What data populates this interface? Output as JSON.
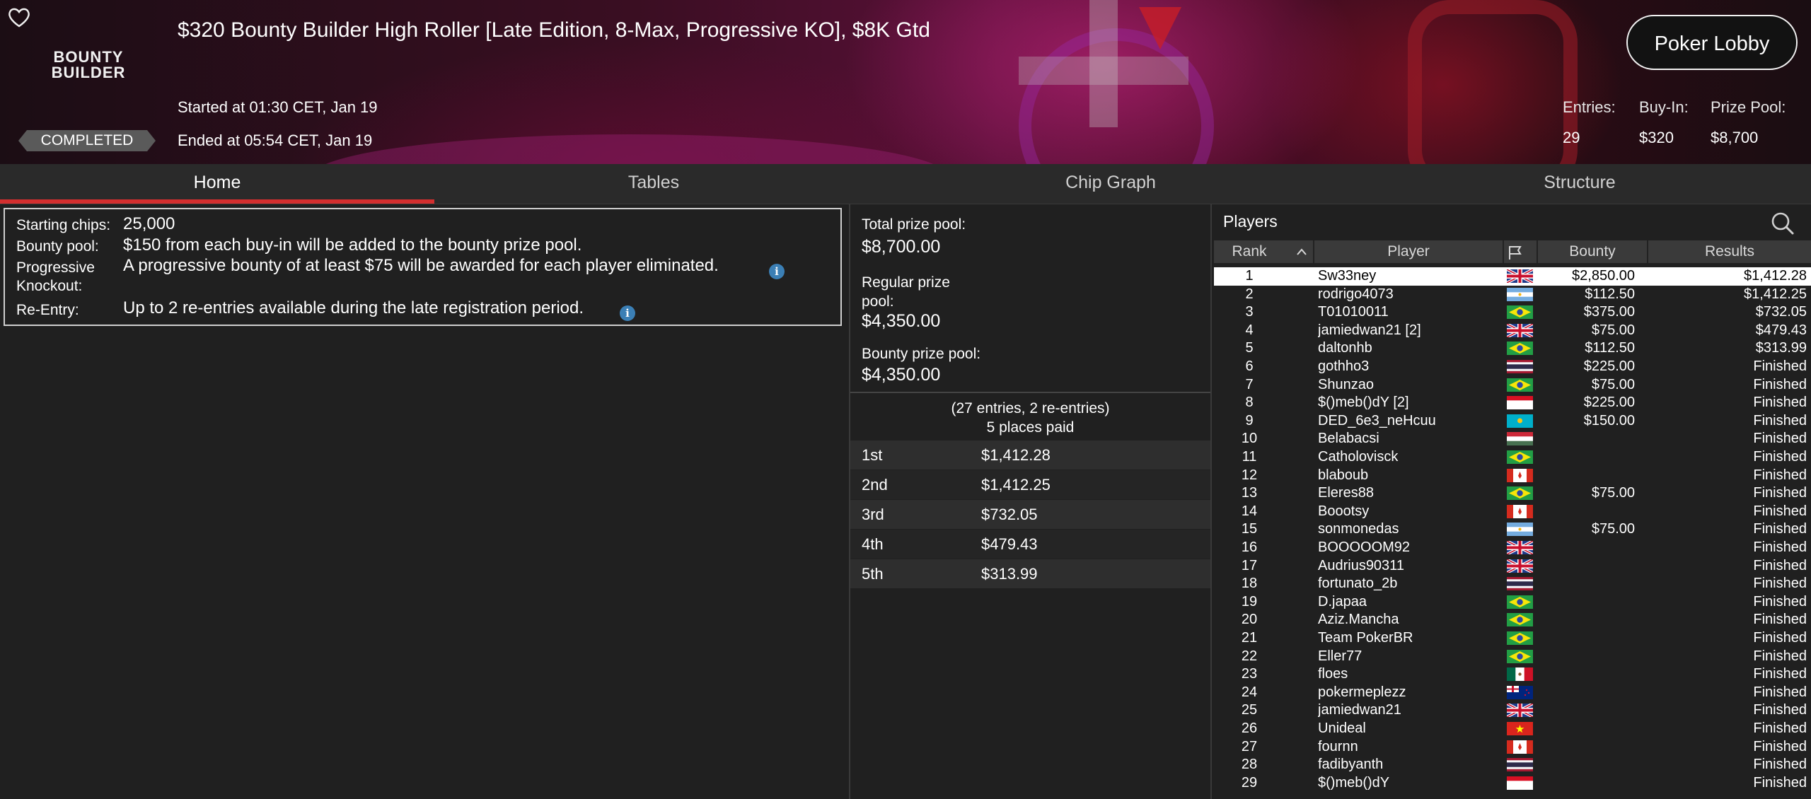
{
  "header": {
    "logo_line1": "BOUNTY",
    "logo_line2": "BUILDER",
    "status_badge": "COMPLETED",
    "title": "$320 Bounty Builder High Roller [Late Edition, 8-Max, Progressive KO], $8K Gtd",
    "started": "Started at 01:30 CET, Jan 19",
    "ended": "Ended at 05:54 CET, Jan 19",
    "lobby_button": "Poker Lobby",
    "stats": {
      "entries_label": "Entries:",
      "entries_value": "29",
      "buyin_label": "Buy-In:",
      "buyin_value": "$320",
      "prize_label": "Prize Pool:",
      "prize_value": "$8,700"
    },
    "icons": [
      "heart-icon"
    ]
  },
  "tabs": [
    {
      "label": "Home",
      "active": true
    },
    {
      "label": "Tables",
      "active": false
    },
    {
      "label": "Chip Graph",
      "active": false
    },
    {
      "label": "Structure",
      "active": false
    }
  ],
  "info": {
    "starting_chips_label": "Starting chips:",
    "starting_chips_value": "25,000",
    "bounty_pool_label": "Bounty pool:",
    "bounty_pool_value": "$150 from each buy-in will be added to the bounty prize pool.",
    "pko_label_1": "Progressive",
    "pko_label_2": "Knockout:",
    "pko_value": "A progressive bounty of at least $75 will be awarded for each player eliminated.",
    "reentry_label": "Re-Entry:",
    "reentry_value": "Up to 2 re-entries available during the late registration period.",
    "info_icon_glyph": "i"
  },
  "prize": {
    "total_label": "Total prize pool:",
    "total_value": "$8,700.00",
    "regular_label_1": "Regular prize",
    "regular_label_2": "pool:",
    "regular_value": "$4,350.00",
    "bounty_label": "Bounty prize pool:",
    "bounty_value": "$4,350.00",
    "entries_note": "(27 entries, 2 re-entries)",
    "places_paid": "5 places paid",
    "places": [
      {
        "place": "1st",
        "amount": "$1,412.28"
      },
      {
        "place": "2nd",
        "amount": "$1,412.25"
      },
      {
        "place": "3rd",
        "amount": "$732.05"
      },
      {
        "place": "4th",
        "amount": "$479.43"
      },
      {
        "place": "5th",
        "amount": "$313.99"
      }
    ]
  },
  "players": {
    "title": "Players",
    "columns": {
      "rank": "Rank",
      "player": "Player",
      "bounty": "Bounty",
      "results": "Results"
    },
    "selected_rank": 1,
    "rows": [
      {
        "rank": "1",
        "name": "Sw33ney",
        "flag": "gb",
        "bounty": "$2,850.00",
        "result": "$1,412.28"
      },
      {
        "rank": "2",
        "name": "rodrigo4073",
        "flag": "ar",
        "bounty": "$112.50",
        "result": "$1,412.25"
      },
      {
        "rank": "3",
        "name": "T01010011",
        "flag": "br",
        "bounty": "$375.00",
        "result": "$732.05"
      },
      {
        "rank": "4",
        "name": "jamiedwan21 [2]",
        "flag": "gb",
        "bounty": "$75.00",
        "result": "$479.43"
      },
      {
        "rank": "5",
        "name": "daltonhb",
        "flag": "br",
        "bounty": "$112.50",
        "result": "$313.99"
      },
      {
        "rank": "6",
        "name": "gothho3",
        "flag": "th",
        "bounty": "$225.00",
        "result": "Finished"
      },
      {
        "rank": "7",
        "name": "Shunzao",
        "flag": "br",
        "bounty": "$75.00",
        "result": "Finished"
      },
      {
        "rank": "8",
        "name": "$()meb()dY [2]",
        "flag": "pe",
        "bounty": "$225.00",
        "result": "Finished"
      },
      {
        "rank": "9",
        "name": "DED_6e3_neHcuu",
        "flag": "kz",
        "bounty": "$150.00",
        "result": "Finished"
      },
      {
        "rank": "10",
        "name": "Belabacsi",
        "flag": "hu",
        "bounty": "",
        "result": "Finished"
      },
      {
        "rank": "11",
        "name": "Catholovisck",
        "flag": "br",
        "bounty": "",
        "result": "Finished"
      },
      {
        "rank": "12",
        "name": "blaboub",
        "flag": "ca",
        "bounty": "",
        "result": "Finished"
      },
      {
        "rank": "13",
        "name": "Eleres88",
        "flag": "br",
        "bounty": "$75.00",
        "result": "Finished"
      },
      {
        "rank": "14",
        "name": "Boootsy",
        "flag": "ca",
        "bounty": "",
        "result": "Finished"
      },
      {
        "rank": "15",
        "name": "sonmonedas",
        "flag": "ar",
        "bounty": "$75.00",
        "result": "Finished"
      },
      {
        "rank": "16",
        "name": "BOOOOOM92",
        "flag": "gb",
        "bounty": "",
        "result": "Finished"
      },
      {
        "rank": "17",
        "name": "Audrius90311",
        "flag": "gb",
        "bounty": "",
        "result": "Finished"
      },
      {
        "rank": "18",
        "name": "fortunato_2b",
        "flag": "th",
        "bounty": "",
        "result": "Finished"
      },
      {
        "rank": "19",
        "name": "D.japaa",
        "flag": "br",
        "bounty": "",
        "result": "Finished"
      },
      {
        "rank": "20",
        "name": "Aziz.Mancha",
        "flag": "br",
        "bounty": "",
        "result": "Finished"
      },
      {
        "rank": "21",
        "name": "Team PokerBR",
        "flag": "br",
        "bounty": "",
        "result": "Finished"
      },
      {
        "rank": "22",
        "name": "Eller77",
        "flag": "br",
        "bounty": "",
        "result": "Finished"
      },
      {
        "rank": "23",
        "name": "floes",
        "flag": "mx",
        "bounty": "",
        "result": "Finished"
      },
      {
        "rank": "24",
        "name": "pokermeplezz",
        "flag": "nz",
        "bounty": "",
        "result": "Finished"
      },
      {
        "rank": "25",
        "name": "jamiedwan21",
        "flag": "gb",
        "bounty": "",
        "result": "Finished"
      },
      {
        "rank": "26",
        "name": "Unideal",
        "flag": "vn",
        "bounty": "",
        "result": "Finished"
      },
      {
        "rank": "27",
        "name": "fournn",
        "flag": "ca",
        "bounty": "",
        "result": "Finished"
      },
      {
        "rank": "28",
        "name": "fadibyanth",
        "flag": "th",
        "bounty": "",
        "result": "Finished"
      },
      {
        "rank": "29",
        "name": "$()meb()dY",
        "flag": "pe",
        "bounty": "",
        "result": "Finished"
      }
    ]
  },
  "colors": {
    "accent_red": "#d32f2f",
    "info_blue": "#3b7fb5",
    "panel_bg": "#202020",
    "badge_grey": "#5a5a5a"
  }
}
